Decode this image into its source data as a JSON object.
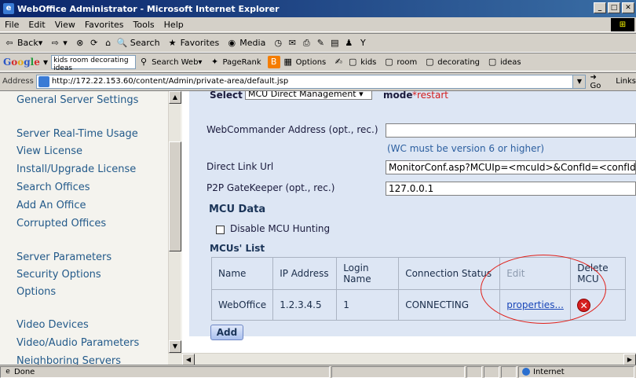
{
  "window": {
    "title": "WebOffice Administrator - Microsoft Internet Explorer",
    "minimize": "_",
    "maximize": "□",
    "close": "✕"
  },
  "menu": [
    "File",
    "Edit",
    "View",
    "Favorites",
    "Tools",
    "Help"
  ],
  "toolbar": {
    "back": "Back",
    "search": "Search",
    "favorites": "Favorites",
    "media": "Media"
  },
  "google_bar": {
    "search_value": "kids room decorating ideas",
    "search_web": "Search Web",
    "pagerank": "PageRank",
    "options": "Options",
    "terms": [
      "kids",
      "room",
      "decorating",
      "ideas"
    ]
  },
  "address_bar": {
    "label": "Address",
    "url": "http://172.22.153.60/content/Admin/private-area/default.jsp",
    "go": "Go",
    "links": "Links"
  },
  "sidebar": {
    "items": [
      "General Server Settings",
      "Server Real-Time Usage",
      "View License",
      "Install/Upgrade License",
      "Search Offices",
      "Add An Office",
      "Corrupted Offices",
      "Server Parameters",
      "Security Options",
      "Options",
      "Video Devices",
      "Video/Audio Parameters",
      "Neighboring Servers"
    ]
  },
  "main": {
    "select_label": "Select",
    "select_value": "MCU Direct Management",
    "mode_label": "mode",
    "restart_label": "*restart",
    "webcommander_label": "WebCommander Address (opt., rec.)",
    "webcommander_value": "",
    "wc_note": "(WC must be version 6 or higher)",
    "direct_link_label": "Direct Link Url",
    "direct_link_value": "MonitorConf.asp?MCUIp=<mcuId>&ConfId=<confId>",
    "p2p_label": "P2P GateKeeper (opt., rec.)",
    "p2p_value": "127.0.0.1",
    "mcu_data_title": "MCU Data",
    "disable_hunting_label": "Disable MCU Hunting",
    "mcus_list_title": "MCUs' List",
    "table": {
      "headers": [
        "Name",
        "IP Address",
        "Login Name",
        "Connection Status",
        "Edit",
        "Delete MCU"
      ],
      "rows": [
        {
          "name": "WebOffice",
          "ip": "1.2.3.4.5",
          "login": "1",
          "status": "CONNECTING",
          "edit": "properties..."
        }
      ]
    },
    "add_button": "Add"
  },
  "status_bar": {
    "left": "Done",
    "zone": "Internet"
  }
}
